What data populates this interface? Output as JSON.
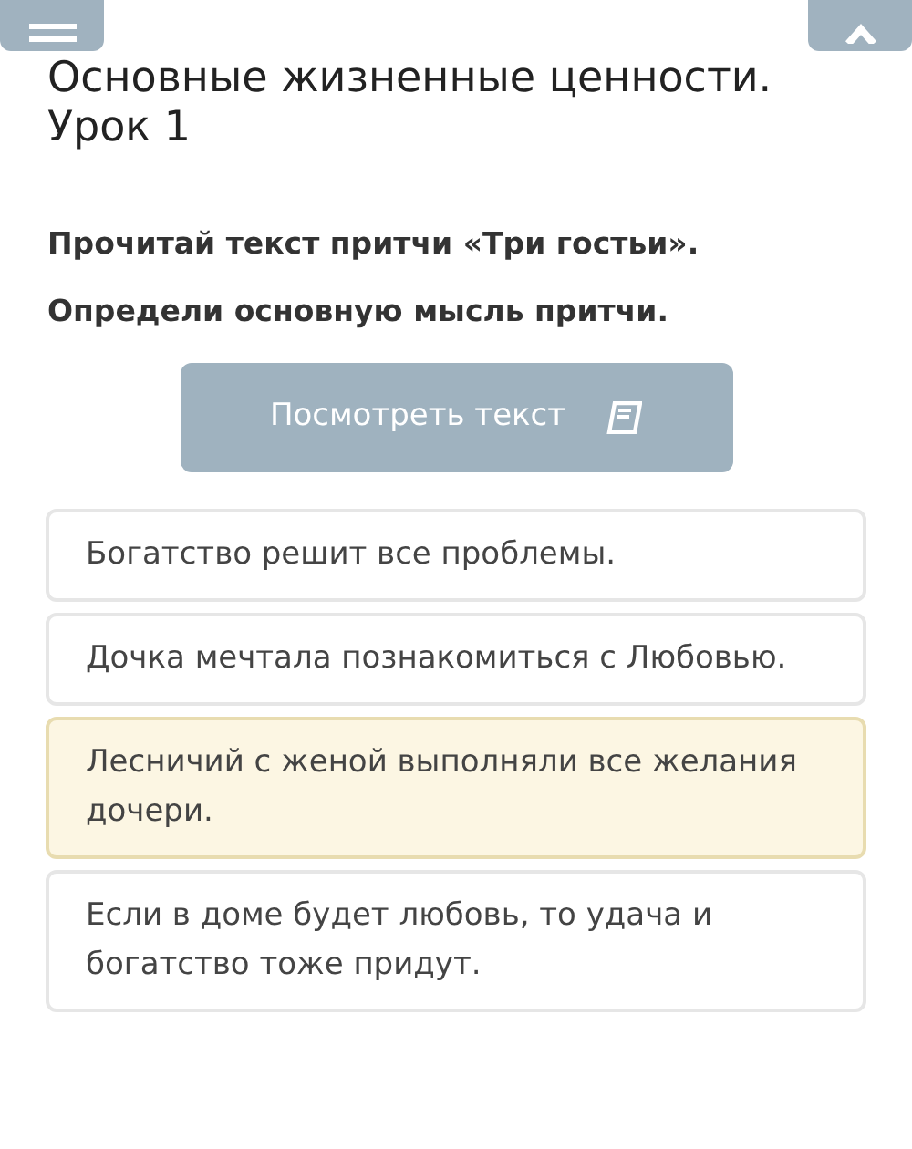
{
  "lesson_title": "Основные жизненные ценности. Урок 1",
  "task": [
    "Прочитай текст притчи «Три гостьи».",
    "Определи основную мысль притчи."
  ],
  "view_text_button": "Посмотреть текст",
  "options": [
    {
      "text": "Богатство решит все проблемы.",
      "selected": false
    },
    {
      "text": "Дочка мечтала познакомиться с Любовью.",
      "selected": false
    },
    {
      "text": "Лесничий с женой выполняли все желания дочери.",
      "selected": true
    },
    {
      "text": "Если в доме будет любовь, то удача и богатство тоже придут.",
      "selected": false
    }
  ]
}
